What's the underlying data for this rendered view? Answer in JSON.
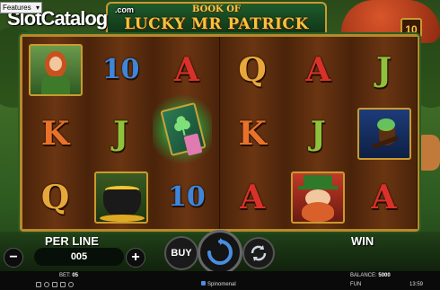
{
  "top_bar": {
    "features_select_value": "Features",
    "brand": "SlotCatalog",
    "brand_suffix": ".com"
  },
  "game": {
    "title_top": "BOOK OF",
    "title_main": "LUCKY MR PATRICK",
    "lines_count": "10"
  },
  "reels": [
    [
      {
        "type": "picture",
        "icon": "red-haired-lady"
      },
      {
        "type": "letter",
        "text": "K",
        "cls": "sym-K"
      },
      {
        "type": "letter",
        "text": "Q",
        "cls": "sym-Q"
      }
    ],
    [
      {
        "type": "letter",
        "text": "10",
        "cls": "sym-10"
      },
      {
        "type": "letter",
        "text": "J",
        "cls": "sym-J"
      },
      {
        "type": "picture",
        "icon": "pot-of-gold"
      }
    ],
    [
      {
        "type": "letter",
        "text": "A",
        "cls": "sym-A"
      },
      {
        "type": "book",
        "icon": "book-scatter"
      },
      {
        "type": "letter",
        "text": "10",
        "cls": "sym-10"
      }
    ],
    [
      {
        "type": "letter",
        "text": "Q",
        "cls": "sym-Q"
      },
      {
        "type": "letter",
        "text": "K",
        "cls": "sym-K"
      },
      {
        "type": "letter",
        "text": "A",
        "cls": "sym-A"
      }
    ],
    [
      {
        "type": "letter",
        "text": "A",
        "cls": "sym-A"
      },
      {
        "type": "letter",
        "text": "J",
        "cls": "sym-J"
      },
      {
        "type": "picture",
        "icon": "leprechaun"
      }
    ],
    [
      {
        "type": "letter",
        "text": "J",
        "cls": "sym-J"
      },
      {
        "type": "picture",
        "icon": "pipe"
      },
      {
        "type": "letter",
        "text": "A",
        "cls": "sym-A"
      }
    ]
  ],
  "controls": {
    "per_line_label": "PER LINE",
    "bet_value": "005",
    "minus": "−",
    "plus": "+",
    "buy_label": "BUY",
    "win_label": "WIN"
  },
  "status": {
    "bet_label": "BET:",
    "bet_value": "05",
    "provider": "Spinomenal",
    "balance_label": "BALANCE:",
    "balance_value": "5000",
    "fun_label": "FUN",
    "time": "13:59"
  },
  "colors": {
    "gold": "#c99a2e",
    "forest": "#3f6b26",
    "reel_wood": "#6a3512"
  }
}
